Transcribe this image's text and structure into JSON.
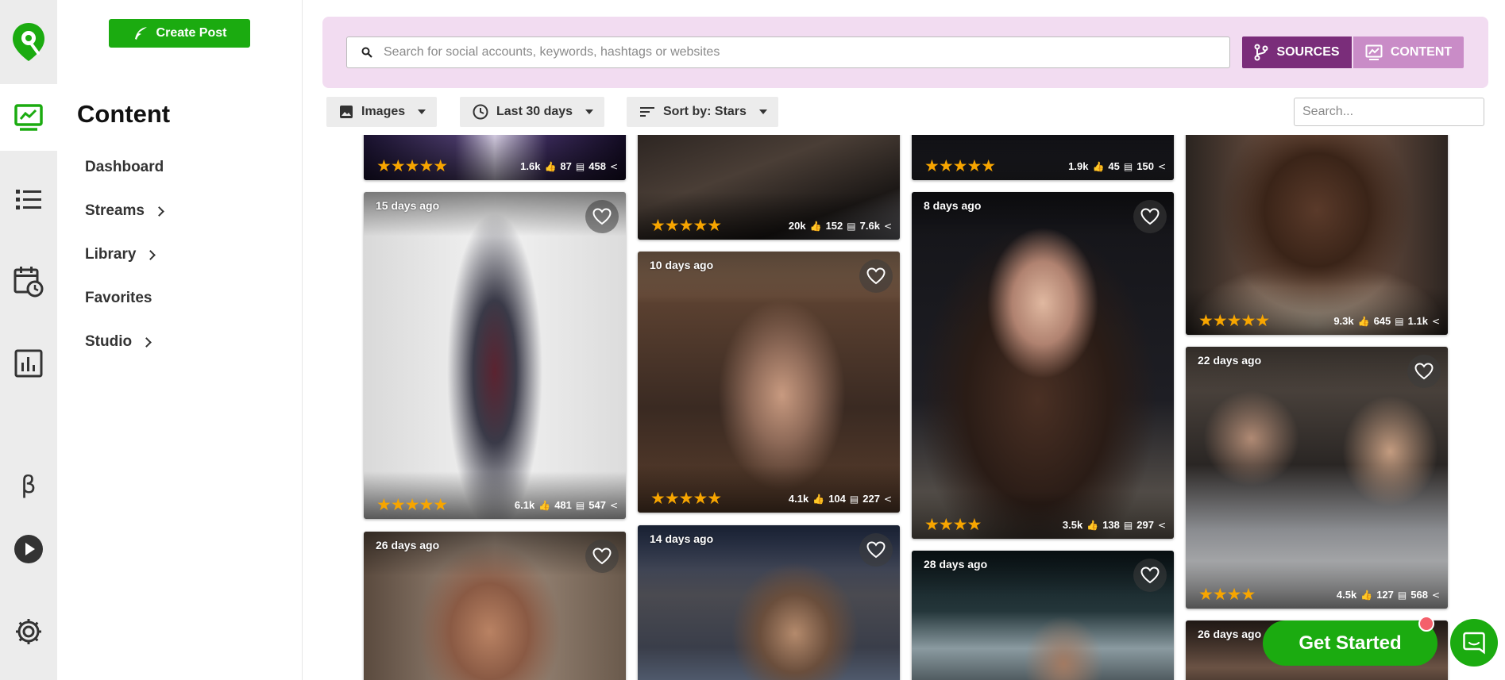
{
  "colors": {
    "brand_green": "#1bab10",
    "sources_purple": "#7a2d7a",
    "content_pink": "#c98cc7",
    "searchbar_bg": "#f2dcf1",
    "star": "#f7a500"
  },
  "rail": {
    "icons": [
      "logo-icon",
      "content-icon",
      "streams-list-icon",
      "schedule-icon",
      "analytics-icon",
      "beta-icon",
      "play-icon",
      "settings-icon"
    ],
    "beta_label": "β"
  },
  "nav": {
    "create_post": "Create Post",
    "title": "Content",
    "items": [
      {
        "label": "Dashboard",
        "has_children": false
      },
      {
        "label": "Streams",
        "has_children": true
      },
      {
        "label": "Library",
        "has_children": true
      },
      {
        "label": "Favorites",
        "has_children": false
      },
      {
        "label": "Studio",
        "has_children": true
      }
    ]
  },
  "search": {
    "placeholder": "Search for social accounts, keywords, hashtags or websites",
    "sources_label": "SOURCES",
    "content_label": "CONTENT"
  },
  "filters": {
    "type": "Images",
    "range": "Last 30 days",
    "sort": "Sort by: Stars",
    "mini_search_placeholder": "Search..."
  },
  "cards": [
    {
      "age": "",
      "stars": "★★★★★",
      "likes": "1.6k",
      "comments": "87",
      "shares": "458"
    },
    {
      "age": "",
      "stars": "★★★★★",
      "likes": "20k",
      "comments": "152",
      "shares": "7.6k"
    },
    {
      "age": "",
      "stars": "★★★★★",
      "likes": "1.9k",
      "comments": "45",
      "shares": "150"
    },
    {
      "age": "",
      "stars": "★★★★★",
      "likes": "9.3k",
      "comments": "645",
      "shares": "1.1k"
    },
    {
      "age": "15 days ago",
      "stars": "★★★★★",
      "likes": "6.1k",
      "comments": "481",
      "shares": "547"
    },
    {
      "age": "10 days ago",
      "stars": "★★★★★",
      "likes": "4.1k",
      "comments": "104",
      "shares": "227"
    },
    {
      "age": "8 days ago",
      "stars": "★★★★",
      "likes": "3.5k",
      "comments": "138",
      "shares": "297"
    },
    {
      "age": "22 days ago",
      "stars": "★★★★",
      "likes": "4.5k",
      "comments": "127",
      "shares": "568"
    },
    {
      "age": "26 days ago",
      "stars": "",
      "likes": "",
      "comments": "",
      "shares": ""
    },
    {
      "age": "14 days ago",
      "stars": "",
      "likes": "",
      "comments": "",
      "shares": ""
    },
    {
      "age": "28 days ago",
      "stars": "",
      "likes": "",
      "comments": "",
      "shares": ""
    },
    {
      "age": "26 days ago",
      "stars": "",
      "likes": "",
      "comments": "",
      "shares": ""
    }
  ],
  "get_started": "Get Started"
}
